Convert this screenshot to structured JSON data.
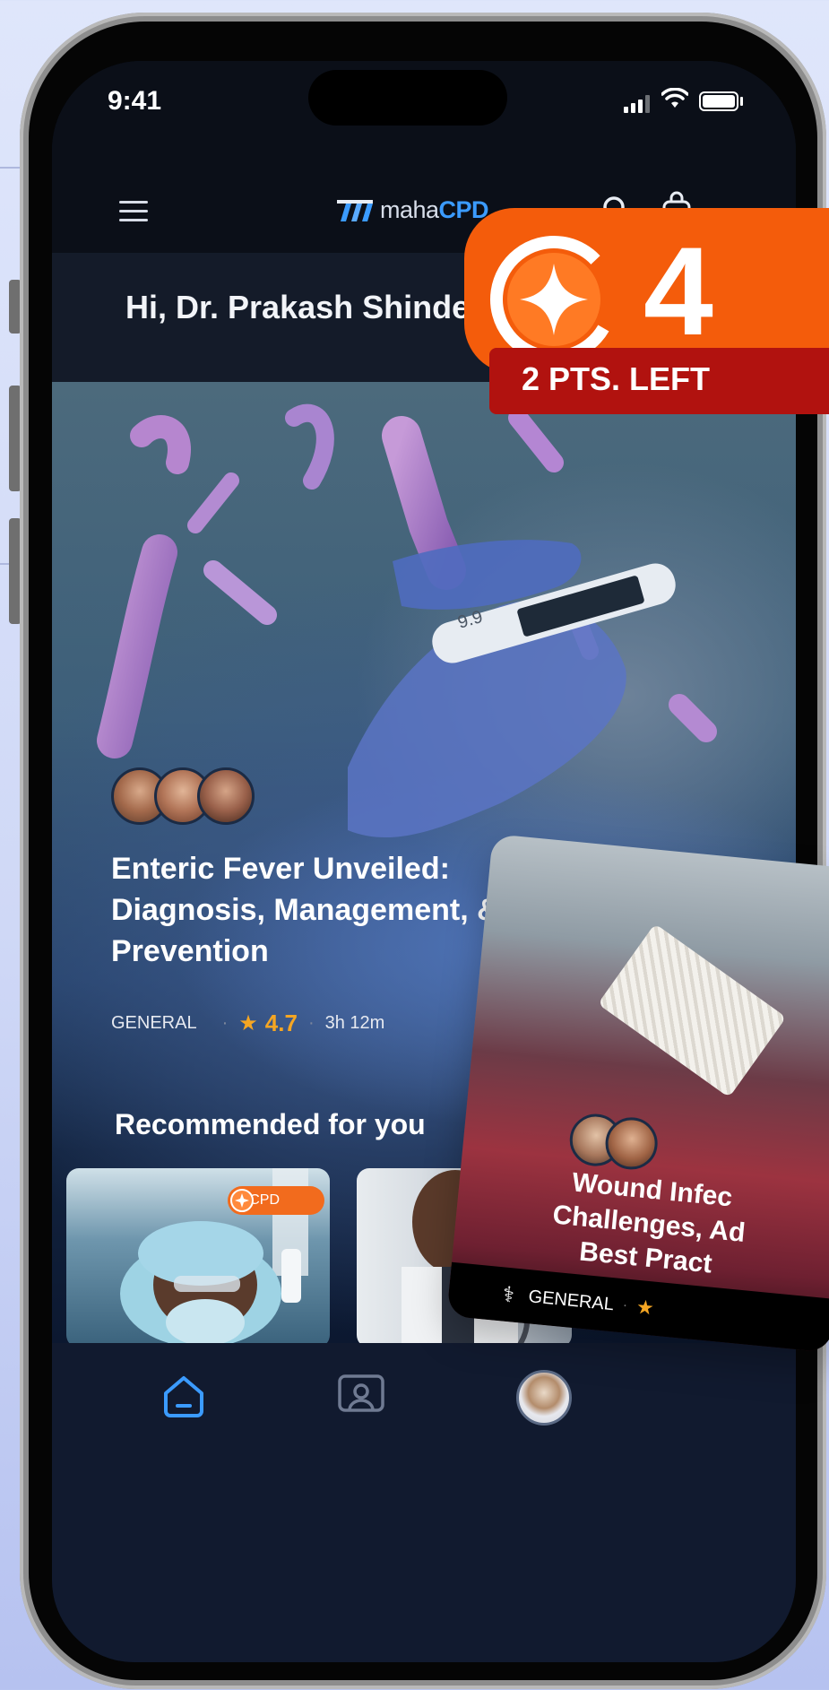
{
  "status_bar": {
    "time": "9:41"
  },
  "header": {
    "logo_prefix": "maha",
    "logo_bold": "CPD"
  },
  "greeting": "Hi, Dr. Prakash Shinde",
  "points": {
    "value": "4",
    "label": "2 PTS. LEFT"
  },
  "hero": {
    "title": "Enteric Fever Unveiled: Diagnosis, Management, & Prevention",
    "category": "GENERAL",
    "rating": "4.7",
    "duration": "3h 12m"
  },
  "recommended": {
    "heading": "Recommended for you",
    "cards": [
      {
        "badge": "+1CPD"
      },
      {}
    ]
  },
  "featured_card": {
    "title": "Wound Infec\nChallenges, Ad\nBest Pract",
    "category": "GENERAL"
  },
  "colors": {
    "accent": "#3b9bff",
    "points_orange": "#f45c0b",
    "points_red": "#b1120f",
    "rating_star": "#f5a623",
    "background": "#0d1526"
  },
  "icons": [
    "menu-icon",
    "search-icon",
    "bag-icon",
    "home-icon",
    "lecture-icon",
    "profile-icon",
    "star-icon",
    "sparkle-icon",
    "caduceus-icon",
    "signal-icon",
    "wifi-icon",
    "battery-icon"
  ]
}
